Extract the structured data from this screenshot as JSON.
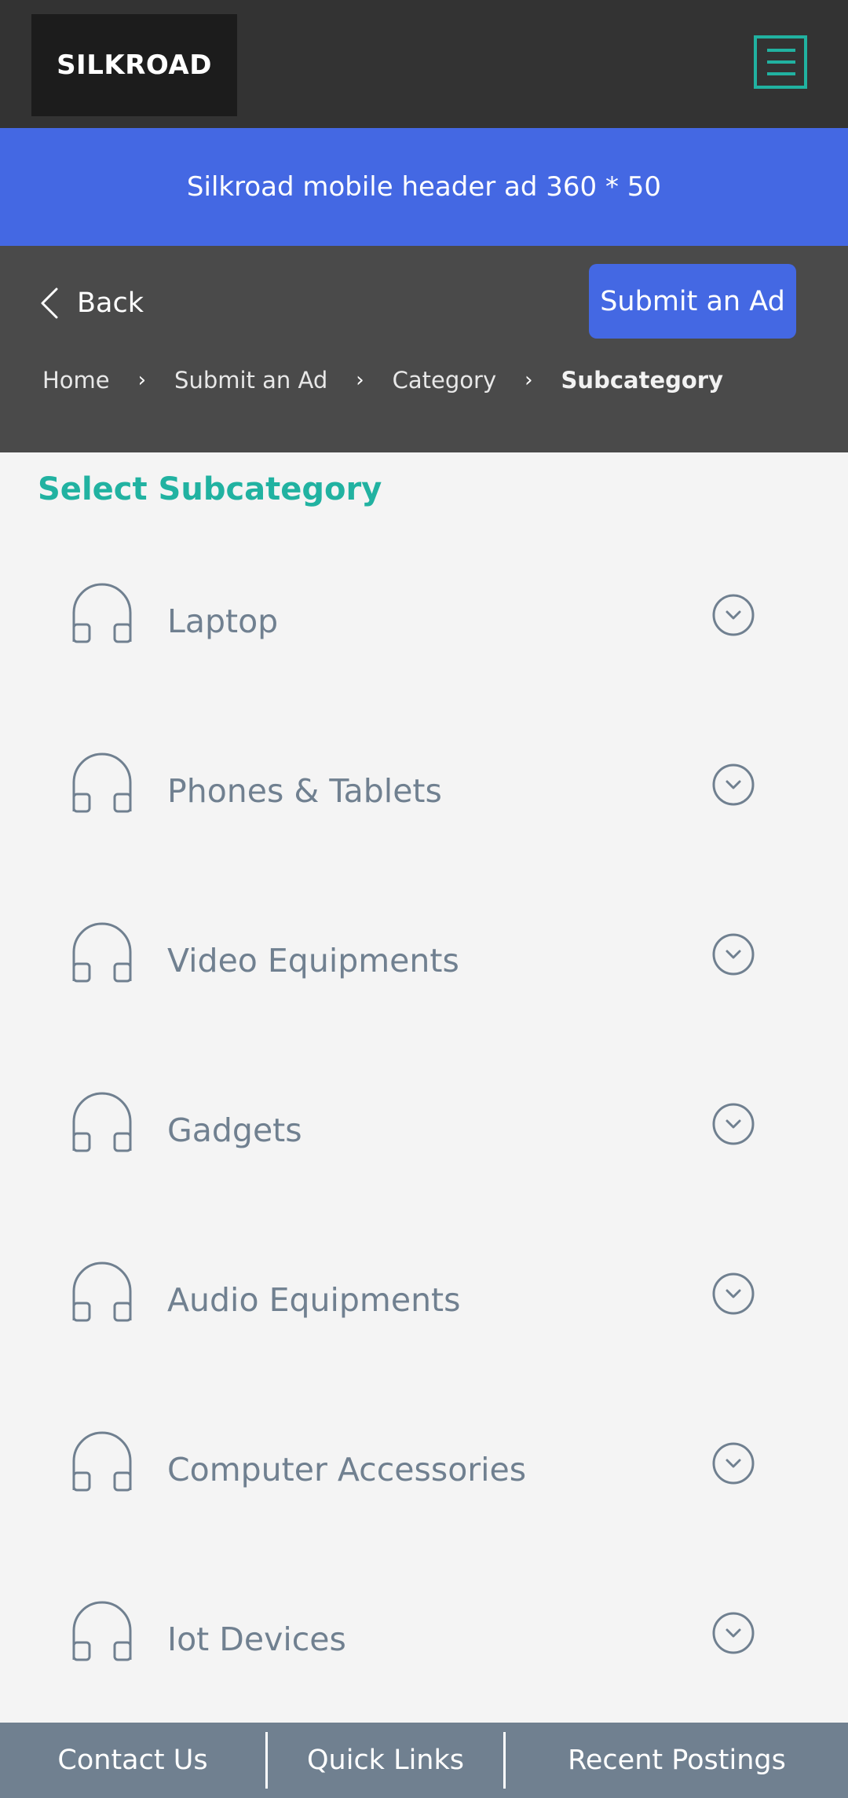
{
  "header": {
    "logo": "SILKROAD",
    "menu_icon": "hamburger-menu-icon",
    "accent_color": "#21b2a1"
  },
  "ad_banner": {
    "text": "Silkroad mobile header ad 360 * 50",
    "color": "#4468e3"
  },
  "nav": {
    "back_label": "Back",
    "submit_ad_label": "Submit an Ad",
    "breadcrumb": [
      {
        "label": "Home"
      },
      {
        "label": "Submit an Ad"
      },
      {
        "label": "Category"
      },
      {
        "label": "Subcategory"
      }
    ]
  },
  "main": {
    "title": "Select Subcategory",
    "items": [
      {
        "label": "Laptop",
        "icon": "headphones-icon"
      },
      {
        "label": "Phones & Tablets",
        "icon": "headphones-icon"
      },
      {
        "label": "Video Equipments",
        "icon": "headphones-icon"
      },
      {
        "label": "Gadgets",
        "icon": "headphones-icon"
      },
      {
        "label": "Audio Equipments",
        "icon": "headphones-icon"
      },
      {
        "label": "Computer Accessories",
        "icon": "headphones-icon"
      },
      {
        "label": "Iot Devices",
        "icon": "headphones-icon"
      }
    ]
  },
  "footer": {
    "links": [
      {
        "label": "Contact Us"
      },
      {
        "label": "Quick Links"
      },
      {
        "label": "Recent Postings"
      }
    ]
  }
}
